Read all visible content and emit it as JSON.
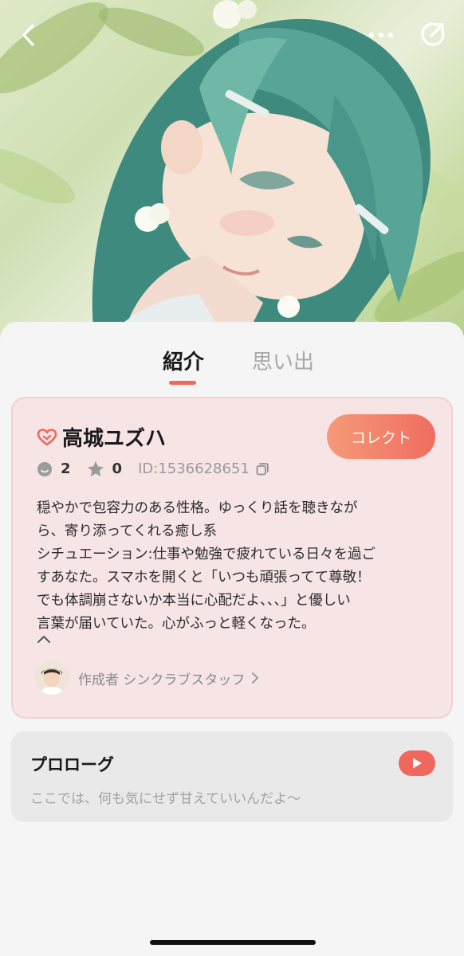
{
  "tabs": [
    {
      "label": "紹介",
      "active": true
    },
    {
      "label": "思い出",
      "active": false
    }
  ],
  "character": {
    "name": "高城ユズハ",
    "collect_label": "コレクト",
    "chats": "2",
    "stars": "0",
    "id_text": "ID:1536628651",
    "description_lines": [
      "穏やかで包容力のある性格。ゆっくり話を聴きなが",
      "ら、寄り添ってくれる癒し系",
      "シチュエーション:仕事や勉強で疲れている日々を過ご",
      "すあなた。スマホを開くと「いつも頑張ってて尊敬！",
      "でも体調崩さないか本当に心配だよ、、、」と優しい",
      "言葉が届いていた。心がふっと軽くなった。"
    ],
    "creator_label": "作成者 シンクラブスタッフ"
  },
  "prologue": {
    "title": "プロローグ",
    "text": "ここでは、何も気にせず甘えていいんだよ〜"
  },
  "colors": {
    "accent": "#f0675e",
    "card_bg": "#f7e4e5",
    "hair": "#4f9a8e"
  },
  "icons": {
    "back": "chevron-left-icon",
    "more": "more-dots-icon",
    "share": "share-icon",
    "heart": "heart-icon",
    "chat": "chat-face-icon",
    "star": "star-icon",
    "copy": "copy-icon",
    "collapse": "chevron-up-icon",
    "creator_arrow": "chevron-right-icon",
    "play": "play-icon"
  }
}
